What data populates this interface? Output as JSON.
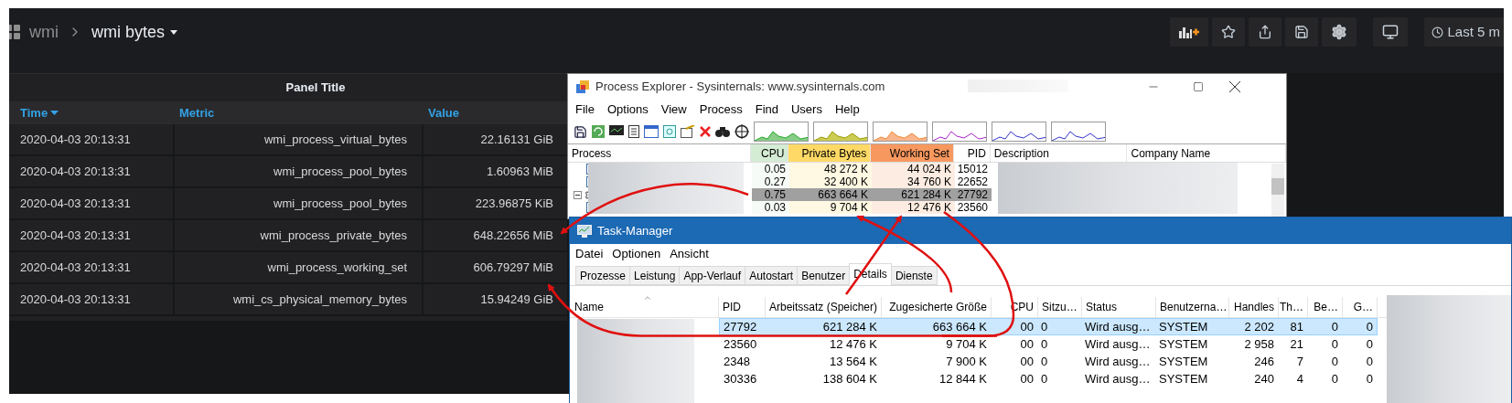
{
  "dashboard": {
    "folder": "wmi",
    "title": "wmi bytes",
    "time_range": "Last 5 m"
  },
  "panel": {
    "title": "Panel Title",
    "columns": [
      {
        "label": "Time",
        "sorted": true
      },
      {
        "label": "Metric",
        "sorted": false
      },
      {
        "label": "Value",
        "sorted": false
      }
    ],
    "rows": [
      [
        "2020-04-03 20:13:31",
        "wmi_process_virtual_bytes",
        "22.16131 GiB"
      ],
      [
        "2020-04-03 20:13:31",
        "wmi_process_pool_bytes",
        "1.60963 MiB"
      ],
      [
        "2020-04-03 20:13:31",
        "wmi_process_pool_bytes",
        "223.96875 KiB"
      ],
      [
        "2020-04-03 20:13:31",
        "wmi_process_private_bytes",
        "648.22656 MiB"
      ],
      [
        "2020-04-03 20:13:31",
        "wmi_process_working_set",
        "606.79297 MiB"
      ],
      [
        "2020-04-03 20:13:31",
        "wmi_cs_physical_memory_bytes",
        "15.94249 GiB"
      ]
    ]
  },
  "process_explorer": {
    "title": "Process Explorer - Sysinternals: www.sysinternals.com",
    "menu": [
      "File",
      "Options",
      "View",
      "Process",
      "Find",
      "Users",
      "Help"
    ],
    "columns": [
      {
        "label": "Process"
      },
      {
        "label": "CPU",
        "color": "#d5ecd4"
      },
      {
        "label": "Private Bytes",
        "color": "#ffd966"
      },
      {
        "label": "Working Set",
        "color": "#f7985f"
      },
      {
        "label": "PID"
      },
      {
        "label": "Description"
      },
      {
        "label": "Company Name"
      }
    ],
    "rows": [
      {
        "kind": "window",
        "cpu": "0.05",
        "private_bytes": "48 272 K",
        "working_set": "44 024 K",
        "pid": "15012",
        "selected": false
      },
      {
        "kind": "window",
        "cpu": "0.27",
        "private_bytes": "32 400 K",
        "working_set": "34 760 K",
        "pid": "22652",
        "selected": false
      },
      {
        "kind": "service",
        "cpu": "0.75",
        "private_bytes": "663 664 K",
        "working_set": "621 284 K",
        "pid": "27792",
        "selected": true
      },
      {
        "kind": "window",
        "cpu": "0.03",
        "private_bytes": "9 704 K",
        "working_set": "12 476 K",
        "pid": "23560",
        "selected": false
      }
    ]
  },
  "task_manager": {
    "title": "Task-Manager",
    "menu": [
      "Datei",
      "Optionen",
      "Ansicht"
    ],
    "tabs": [
      {
        "label": "Prozesse",
        "selected": false
      },
      {
        "label": "Leistung",
        "selected": false
      },
      {
        "label": "App-Verlauf",
        "selected": false
      },
      {
        "label": "Autostart",
        "selected": false
      },
      {
        "label": "Benutzer",
        "selected": false
      },
      {
        "label": "Details",
        "selected": true
      },
      {
        "label": "Dienste",
        "selected": false
      }
    ],
    "name_column": "Name",
    "columns": [
      "PID",
      "Arbeitssatz (Speicher)",
      "Zugesicherte Größe",
      "CPU",
      "Sitzu…",
      "Status",
      "Benutzerna…",
      "Handles",
      "Th…",
      "Be…",
      "G…"
    ],
    "rows": [
      {
        "cells": [
          "27792",
          "621 284 K",
          "663 664 K",
          "00",
          "0",
          "Wird ausg…",
          "SYSTEM",
          "2 202",
          "81",
          "0",
          "0"
        ],
        "selected": true
      },
      {
        "cells": [
          "23560",
          "12 476 K",
          "9 704 K",
          "00",
          "0",
          "Wird ausg…",
          "SYSTEM",
          "2 958",
          "21",
          "0",
          "0"
        ],
        "selected": false
      },
      {
        "cells": [
          "2348",
          "13 564 K",
          "7 900 K",
          "00",
          "0",
          "Wird ausg…",
          "SYSTEM",
          "246",
          "7",
          "0",
          "0"
        ],
        "selected": false
      },
      {
        "cells": [
          "30336",
          "138 604 K",
          "12 844 K",
          "00",
          "0",
          "Wird ausg…",
          "SYSTEM",
          "240",
          "4",
          "0",
          "0"
        ],
        "selected": false
      }
    ]
  }
}
